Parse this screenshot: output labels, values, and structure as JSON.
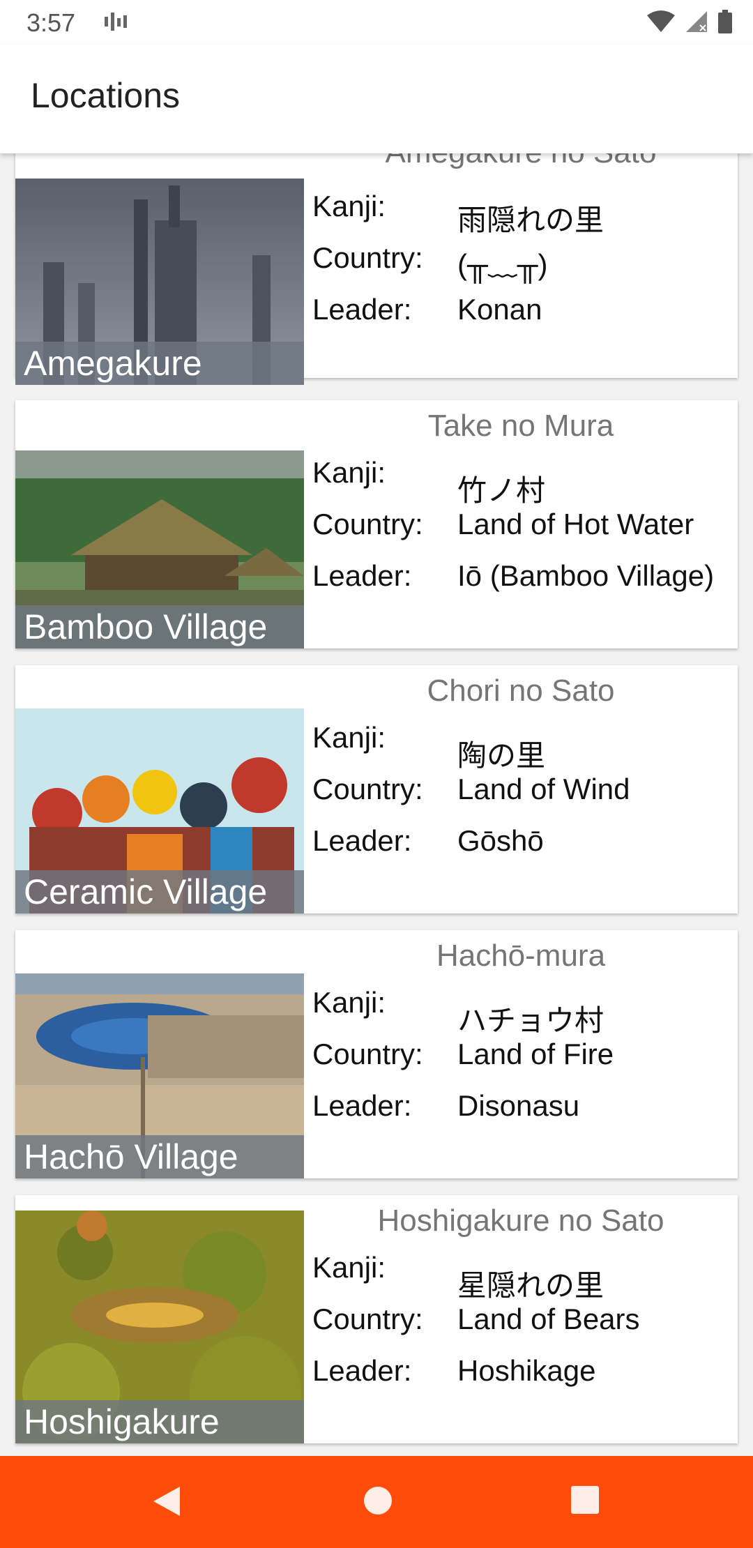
{
  "status_bar": {
    "time": "3:57"
  },
  "app_bar": {
    "title": "Locations"
  },
  "labels": {
    "kanji": "Kanji:",
    "country": "Country:",
    "leader": "Leader:"
  },
  "cards": [
    {
      "title": "Amegakure no Sato",
      "caption": "Amegakure",
      "kanji": "雨隠れの里",
      "country": "(╥﹏╥)",
      "leader": "Konan"
    },
    {
      "title": "Take no Mura",
      "caption": "Bamboo Village",
      "kanji": "竹ノ村",
      "country": "Land of Hot Water",
      "leader": "Iō (Bamboo Village)"
    },
    {
      "title": "Chori no Sato",
      "caption": "Ceramic Village",
      "kanji": "陶の里",
      "country": "Land of Wind",
      "leader": "Gōshō"
    },
    {
      "title": "Hachō-mura",
      "caption": "Hachō Village",
      "kanji": "ハチョウ村",
      "country": "Land of Fire",
      "leader": "Disonasu"
    },
    {
      "title": "Hoshigakure no Sato",
      "caption": "Hoshigakure",
      "kanji": "星隠れの里",
      "country": "Land of Bears",
      "leader": "Hoshikage"
    }
  ],
  "colors": {
    "nav_bar": "#ff4c0a",
    "title_gray": "#757575",
    "caption_bg": "#6e7680"
  }
}
